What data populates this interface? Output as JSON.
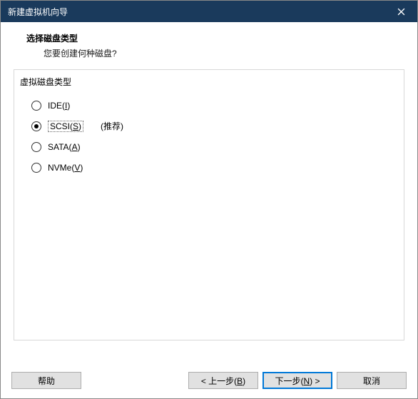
{
  "titlebar": {
    "text": "新建虚拟机向导"
  },
  "header": {
    "title": "选择磁盘类型",
    "subtitle": "您要创建何种磁盘?"
  },
  "group": {
    "label": "虚拟磁盘类型",
    "options": [
      {
        "prefix": "IDE(",
        "hotkey": "I",
        "suffix": ")",
        "selected": false,
        "hint": ""
      },
      {
        "prefix": "SCSI(",
        "hotkey": "S",
        "suffix": ")",
        "selected": true,
        "hint": "(推荐)"
      },
      {
        "prefix": "SATA(",
        "hotkey": "A",
        "suffix": ")",
        "selected": false,
        "hint": ""
      },
      {
        "prefix": "NVMe(",
        "hotkey": "V",
        "suffix": ")",
        "selected": false,
        "hint": ""
      }
    ]
  },
  "footer": {
    "help": "帮助",
    "back_prefix": "< 上一步(",
    "back_hotkey": "B",
    "back_suffix": ")",
    "next_prefix": "下一步(",
    "next_hotkey": "N",
    "next_suffix": ") >",
    "cancel": "取消"
  }
}
